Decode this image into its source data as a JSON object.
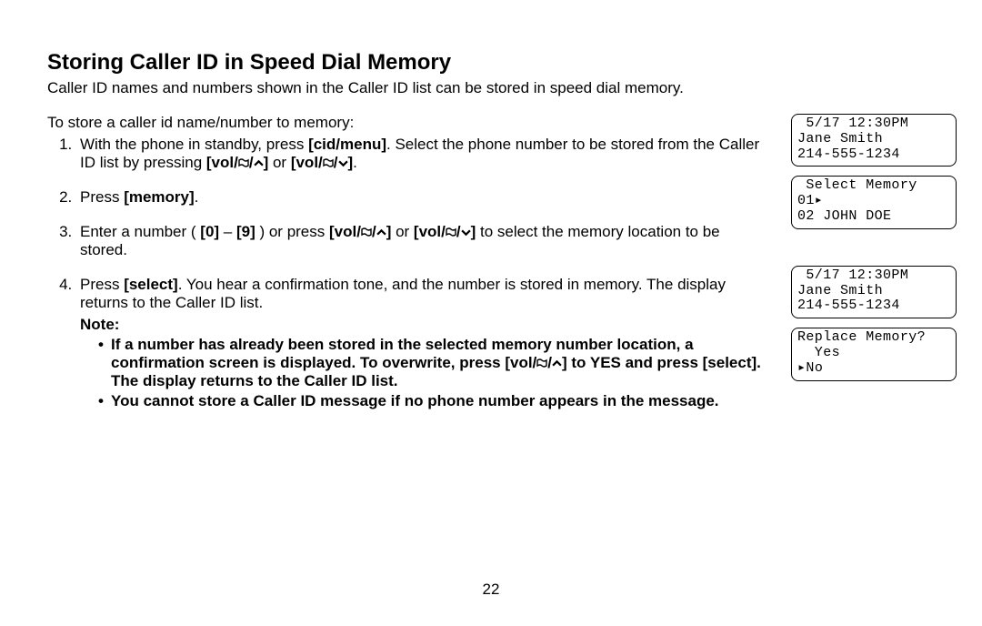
{
  "heading": "Storing Caller ID in Speed Dial Memory",
  "intro": "Caller ID names and numbers shown in the Caller ID list can be stored in speed dial memory.",
  "lead": "To store a caller id name/number to memory:",
  "steps": {
    "s1a": "With the phone in standby, press ",
    "s1b": "[cid/menu]",
    "s1c": ". Select the phone number to be stored from the Caller ID list by pressing ",
    "s1d": "[vol/",
    "s1e": "]",
    "s1f": " or ",
    "s1g": "[vol/",
    "s1h": "]",
    "s1i": ".",
    "s2a": "Press ",
    "s2b": "[memory]",
    "s2c": ".",
    "s3a": "Enter a number ( ",
    "s3b": "[0]",
    "s3c": " – ",
    "s3d": "[9]",
    "s3e": " ) or press ",
    "s3f": "[vol/",
    "s3g": "]",
    "s3h": " or ",
    "s3i": "[vol/",
    "s3j": "]",
    "s3k": " to select the memory location to be stored.",
    "s4a": "Press ",
    "s4b": "[select]",
    "s4c": ". You hear a confirmation tone, and the number is stored in memory. The display returns to the Caller ID list.",
    "note_label": "Note:",
    "n1a": "If a number has already been stored in the selected memory number location, a confirmation screen is displayed. To overwrite, press [vol/",
    "n1b": "] to YES and press [select]. The display returns to the Caller ID list.",
    "n2": "You cannot store a Caller ID message if no phone number appears in the message."
  },
  "lcd": {
    "a": " 5/17 12:30PM\nJane Smith\n214-555-1234",
    "b": " Select Memory\n01▸\n02 JOHN DOE",
    "c": " 5/17 12:30PM\nJane Smith\n214-555-1234",
    "d": "Replace Memory?\n  Yes\n▸No"
  },
  "page_number": "22"
}
